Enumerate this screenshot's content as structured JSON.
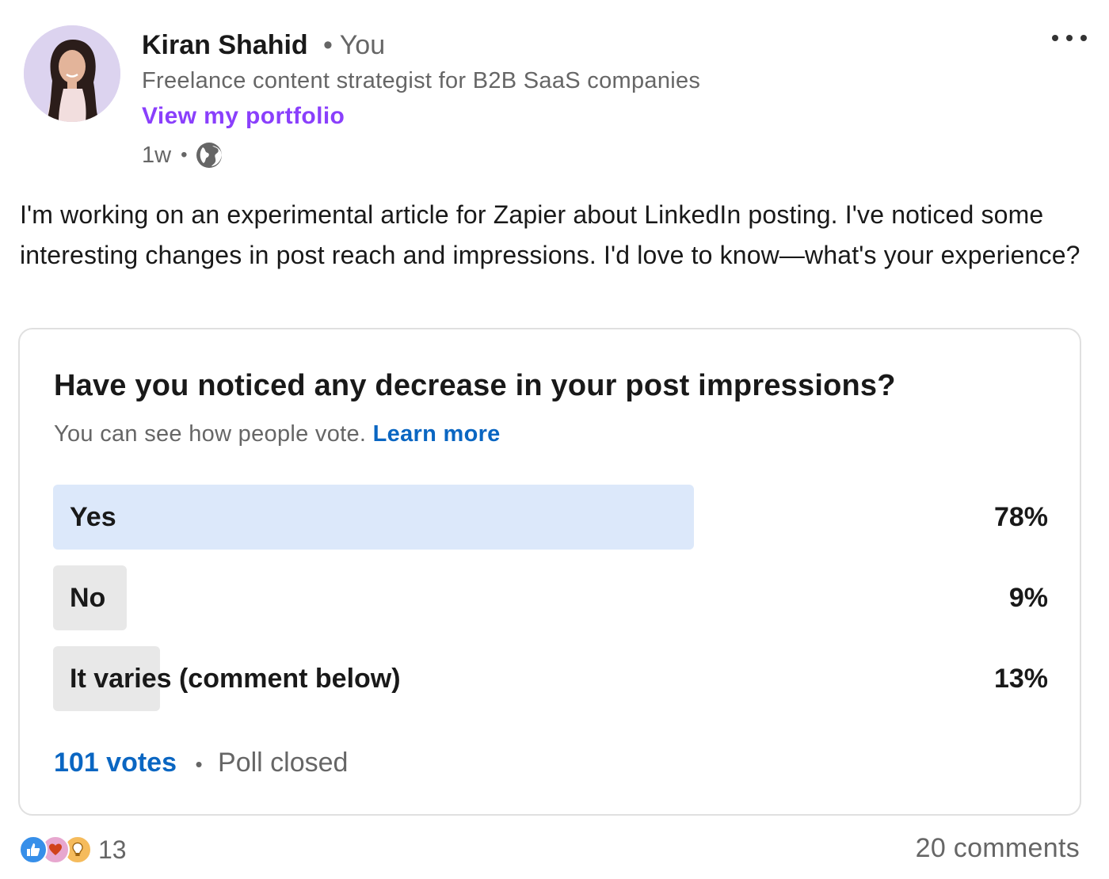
{
  "author": {
    "name": "Kiran Shahid",
    "relation": "• You",
    "headline": "Freelance content strategist for B2B SaaS companies",
    "link_label": "View my portfolio",
    "time": "1w",
    "time_separator": "•",
    "visibility_icon": "globe-icon"
  },
  "post": {
    "text": "I'm working on an experimental article for Zapier about LinkedIn posting. I've noticed some interesting changes in post reach and impressions. I'd love to know—what's your experience?"
  },
  "poll": {
    "question": "Have you noticed any decrease in your post impressions?",
    "note": "You can see how people vote.",
    "learn_more": "Learn more",
    "options": [
      {
        "label": "Yes",
        "percent_label": "78%",
        "percent": 78
      },
      {
        "label": "No",
        "percent_label": "9%",
        "percent": 9
      },
      {
        "label": "It varies (comment below)",
        "percent_label": "13%",
        "percent": 13
      }
    ],
    "votes": "101 votes",
    "separator": "•",
    "status": "Poll closed"
  },
  "social": {
    "reaction_icons": [
      "like-icon",
      "love-icon",
      "insightful-icon"
    ],
    "reaction_count": "13",
    "comments": "20 comments"
  },
  "colors": {
    "link_purple": "#8a3ffc",
    "link_blue": "#0a66c2",
    "winner_fill": "#dce8fa",
    "option_fill": "#e8e8e8"
  }
}
